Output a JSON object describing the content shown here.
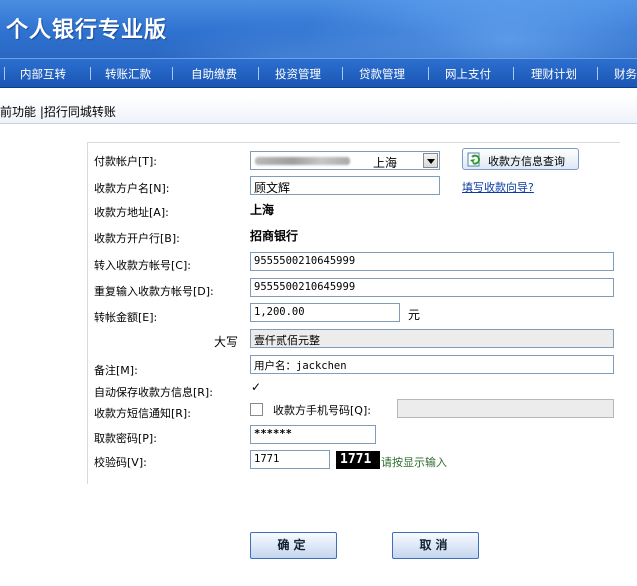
{
  "header": {
    "title": "个人银行专业版"
  },
  "nav": {
    "items": [
      "内部互转",
      "转账汇款",
      "自助缴费",
      "投资管理",
      "贷款管理",
      "网上支付",
      "理财计划",
      "财务"
    ]
  },
  "breadcrumb": {
    "text": "前功能 |招行同城转账"
  },
  "form": {
    "payer_account": {
      "label": "付款帐户[T]:",
      "city": "上海"
    },
    "query_button": "收款方信息查询",
    "wizard_link": "填写收款向导?",
    "payee_name": {
      "label": "收款方户名[N]:",
      "value": "顾文辉"
    },
    "payee_address": {
      "label": "收款方地址[A]:",
      "value": "上海"
    },
    "payee_bank": {
      "label": "收款方开户行[B]:",
      "value": "招商银行"
    },
    "payee_account": {
      "label": "转入收款方帐号[C]:",
      "value": "9555500210645999"
    },
    "payee_account_confirm": {
      "label": "重复输入收款方帐号[D]:",
      "value": "9555500210645999"
    },
    "amount": {
      "label": "转帐金额[E]:",
      "value": "1,200.00",
      "unit": "元"
    },
    "amount_upper": {
      "label": "大写",
      "value": "壹仟贰佰元整"
    },
    "remark": {
      "label": "备注[M]:",
      "value": "用户名：jackchen"
    },
    "save_payee": {
      "label": "自动保存收款方信息[R]:",
      "checked": true
    },
    "sms_notify": {
      "label": "收款方短信通知[R]:",
      "checked": false,
      "phone_label": "收款方手机号码[Q]:"
    },
    "password": {
      "label": "取款密码[P]:",
      "value": "******"
    },
    "captcha": {
      "label": "校验码[V]:",
      "value": "1771",
      "image_text": "1771",
      "hint": "请按显示输入"
    }
  },
  "buttons": {
    "confirm": "确定",
    "cancel": "取消"
  }
}
